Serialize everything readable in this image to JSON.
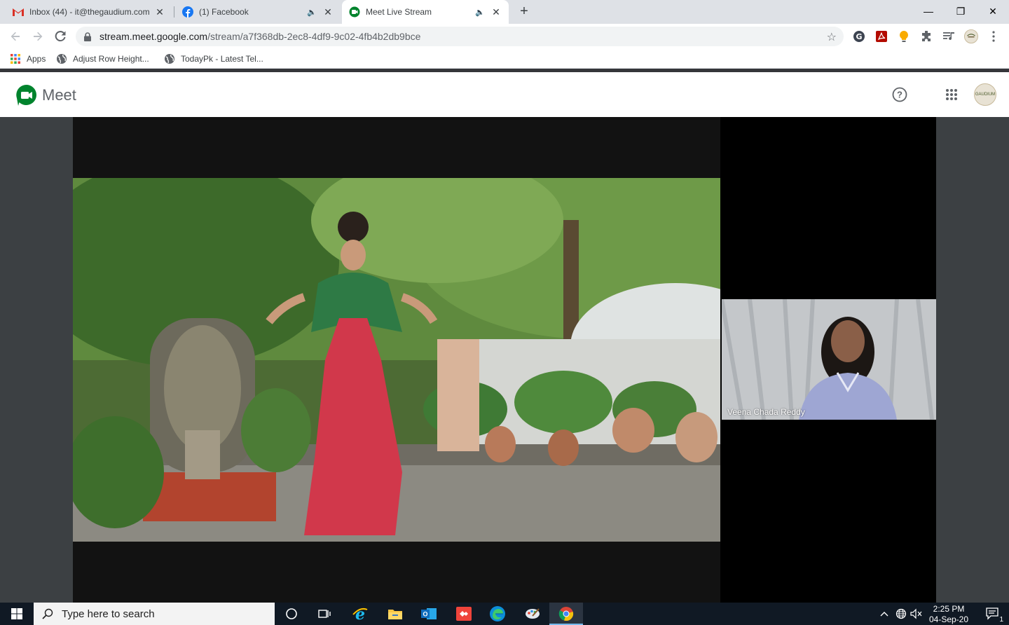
{
  "browser": {
    "tabs": [
      {
        "title": "Inbox (44) - it@thegaudium.com",
        "icon": "gmail-icon",
        "audio": false,
        "active": false
      },
      {
        "title": "(1) Facebook",
        "icon": "facebook-icon",
        "audio": true,
        "active": false
      },
      {
        "title": "Meet Live Stream",
        "icon": "meet-icon",
        "audio": true,
        "active": true
      }
    ],
    "close_glyph": "✕",
    "new_tab_glyph": "+",
    "window_controls": {
      "minimize": "—",
      "restore": "❐",
      "close": "✕"
    },
    "url": {
      "host": "stream.meet.google.com",
      "path": "/stream/a7f368db-2ec8-4df9-9c02-4fb4b2db9bce"
    },
    "bookmarks": [
      {
        "label": "Apps",
        "icon": "apps-grid-icon"
      },
      {
        "label": "Adjust Row Height...",
        "icon": "globe-icon"
      },
      {
        "label": "TodayPk - Latest Tel...",
        "icon": "globe-icon"
      }
    ],
    "extensions": [
      "grammarly-icon",
      "acrobat-icon",
      "bulb-icon",
      "puzzle-icon",
      "media-control-icon",
      "profile-avatar-icon",
      "menu-dots-icon"
    ]
  },
  "meet": {
    "app_name": "Meet",
    "header_icons": [
      "help-icon",
      "apps-grid-icon",
      "account-avatar"
    ],
    "avatar_text": "GAUDIUM",
    "participant_name": "Veena Chada Reddy"
  },
  "taskbar": {
    "search_placeholder": "Type here to search",
    "pinned": [
      "cortana-icon",
      "task-view-icon",
      "ie-icon",
      "file-explorer-icon",
      "outlook-icon",
      "anydesk-icon",
      "edge-icon",
      "paint-icon",
      "chrome-icon"
    ],
    "time": "2:25 PM",
    "date": "04-Sep-20",
    "notification_count": "1"
  },
  "colors": {
    "chrome_tab_strip": "#dee1e6",
    "meet_green": "#00832d",
    "taskbar": "#101924",
    "stage": "#3c4043"
  }
}
